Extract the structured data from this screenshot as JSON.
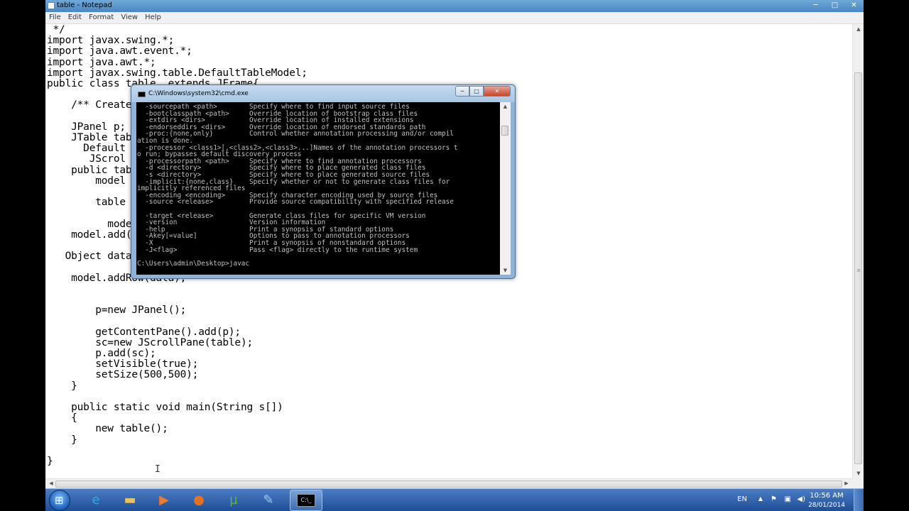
{
  "notepad": {
    "title": "table - Notepad",
    "window_controls": {
      "minimize": "─",
      "maximize": "□",
      "close": "✕"
    },
    "menu": [
      "File",
      "Edit",
      "Format",
      "View",
      "Help"
    ],
    "code_lines": [
      " */",
      "import javax.swing.*;",
      "import java.awt.event.*;",
      "import java.awt.*;",
      "import javax.swing.table.DefaultTableModel;",
      "public class table  extends JFrame{",
      "",
      "    /** Create",
      "",
      "    JPanel p;",
      "    JTable tab",
      "      Default",
      "       JScrol",
      "    public tab",
      "        model",
      "",
      "        table",
      "",
      "          mode",
      "    model.add(",
      "",
      "   Object data",
      "",
      "    model.addRow(data);",
      "",
      "",
      "        p=new JPanel();",
      "",
      "        getContentPane().add(p);",
      "        sc=new JScrollPane(table);",
      "        p.add(sc);",
      "        setVisible(true);",
      "        setSize(500,500);",
      "    }",
      "",
      "    public static void main(String s[])",
      "    {",
      "        new table();",
      "    }",
      "",
      "}"
    ]
  },
  "cmd": {
    "title": "C:\\Windows\\system32\\cmd.exe",
    "window_controls": {
      "minimize": "─",
      "maximize": "□",
      "close": "✕"
    },
    "lines": [
      "  -sourcepath <path>        Specify where to find input source files",
      "  -bootclasspath <path>     Override location of bootstrap class files",
      "  -extdirs <dirs>           Override location of installed extensions",
      "  -endorseddirs <dirs>      Override location of endorsed standards path",
      "  -proc:{none,only}         Control whether annotation processing and/or compil",
      "ation is done.",
      "  -processor <class1>[,<class2>,<class3>...]Names of the annotation processors t",
      "o run; bypasses default discovery process",
      "  -processorpath <path>     Specify where to find annotation processors",
      "  -d <directory>            Specify where to place generated class files",
      "  -s <directory>            Specify where to place generated source files",
      "  -implicit:{none,class}    Specify whether or not to generate class files for",
      "implicitly referenced files",
      "  -encoding <encoding>      Specify character encoding used by source files",
      "  -source <release>         Provide source compatibility with specified release",
      "",
      "  -target <release>         Generate class files for specific VM version",
      "  -version                  Version information",
      "  -help                     Print a synopsis of standard options",
      "  -Akey[=value]             Options to pass to annotation processors",
      "  -X                        Print a synopsis of nonstandard options",
      "  -J<flag>                  Pass <flag> directly to the runtime system",
      "",
      "C:\\Users\\admin\\Desktop>javac"
    ]
  },
  "taskbar": {
    "apps": [
      {
        "name": "internet-explorer",
        "glyph": "e",
        "color": "#3aa0e8"
      },
      {
        "name": "file-explorer",
        "glyph": "▬",
        "color": "#e8c45a"
      },
      {
        "name": "media-player",
        "glyph": "▶",
        "color": "#f07a2c"
      },
      {
        "name": "firefox",
        "glyph": "●",
        "color": "#e8721c"
      },
      {
        "name": "utorrent",
        "glyph": "µ",
        "color": "#5fb832"
      },
      {
        "name": "notepad",
        "glyph": "✎",
        "color": "#9ad0f0"
      },
      {
        "name": "cmd",
        "glyph": "C:\\_",
        "color": "#000000"
      }
    ],
    "tray": {
      "language": "EN",
      "time": "10:56 AM",
      "date": "28/01/2014"
    }
  }
}
